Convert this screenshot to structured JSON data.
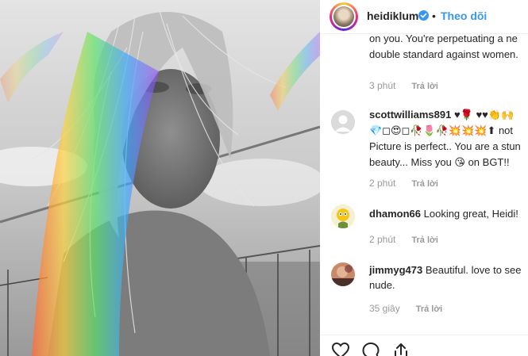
{
  "post": {
    "username": "heidiklum",
    "follow_label": "Theo dõi",
    "separator": "•"
  },
  "comments": [
    {
      "username": "",
      "lines": [
        "on you. You're perpetuating a ne",
        "double standard against women."
      ],
      "time": "3 phút",
      "reply_label": "Trả lời"
    },
    {
      "username": "scottwilliams891",
      "first_line_rest": " ♥🌹 ♥♥👏🙌",
      "lines": [
        "💎◻😍◻🥀🌷🥀💥💥💥⬆ not",
        "Picture is perfect.. You are a stun",
        "beauty... Miss you 😘 on BGT!!"
      ],
      "time": "2 phút",
      "reply_label": "Trả lời"
    },
    {
      "username": "dhamon66",
      "text": " Looking great, Heidi!",
      "time": "2 phút",
      "reply_label": "Trả lời"
    },
    {
      "username": "jimmyg473",
      "text": " Beautiful. love to see",
      "lines": [
        "nude."
      ],
      "time": "35 giây",
      "reply_label": "Trả lời"
    }
  ],
  "icons": {
    "verified": "verified-badge-icon",
    "like": "heart-icon",
    "comment": "comment-icon",
    "share": "share-icon"
  },
  "colors": {
    "link_blue": "#3897f0",
    "verified_blue": "#3897f0",
    "meta_gray": "#999999"
  }
}
